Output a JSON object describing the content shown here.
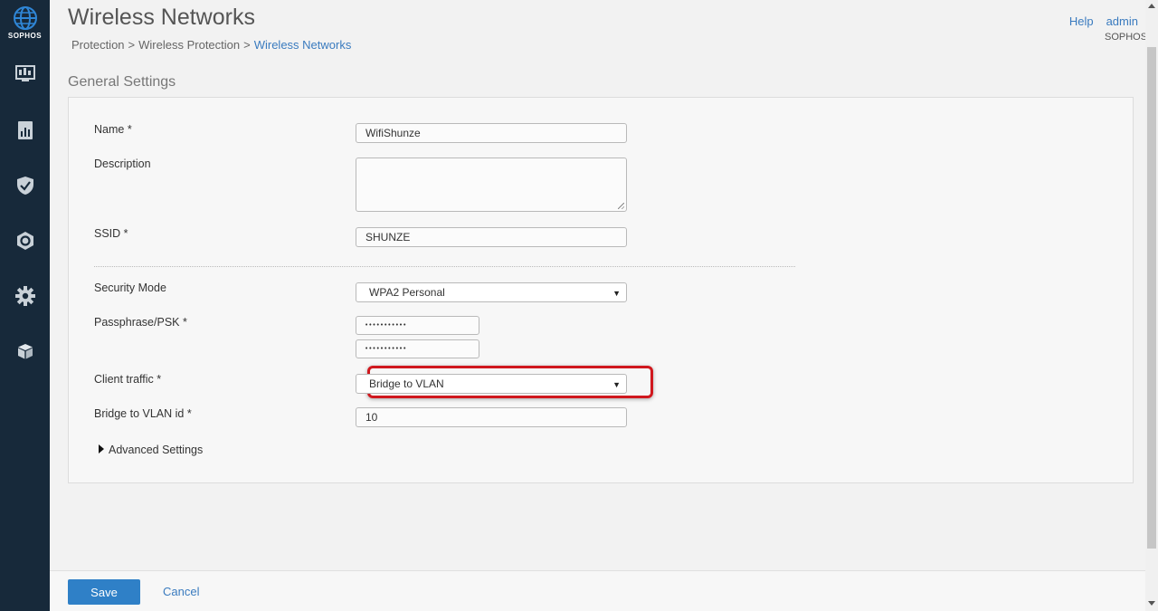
{
  "sidebar": {
    "logo_text": "SOPHOS",
    "items": [
      {
        "icon": "monitor-icon"
      },
      {
        "icon": "reports-icon"
      },
      {
        "icon": "shield-icon"
      },
      {
        "icon": "protect-icon"
      },
      {
        "icon": "gear-icon"
      },
      {
        "icon": "box-icon"
      }
    ]
  },
  "header": {
    "title": "Wireless Networks",
    "breadcrumb": [
      "Protection",
      "Wireless Protection",
      "Wireless Networks"
    ],
    "breadcrumb_sep": ">",
    "help": "Help",
    "user": "admin",
    "company": "SOPHOS"
  },
  "section": {
    "title": "General Settings"
  },
  "form": {
    "name": {
      "label": "Name *",
      "value": "WifiShunze"
    },
    "description": {
      "label": "Description",
      "value": ""
    },
    "ssid": {
      "label": "SSID *",
      "value": "SHUNZE"
    },
    "security_mode": {
      "label": "Security Mode",
      "value": "WPA2 Personal"
    },
    "passphrase": {
      "label": "Passphrase/PSK *",
      "value": "•••••••••••",
      "confirm": "•••••••••••"
    },
    "client_traffic": {
      "label": "Client traffic *",
      "value": "Bridge to VLAN"
    },
    "vlan_id": {
      "label": "Bridge to VLAN id *",
      "value": "10"
    },
    "advanced": {
      "label": "Advanced Settings"
    }
  },
  "footer": {
    "save": "Save",
    "cancel": "Cancel"
  },
  "colors": {
    "sidebar": "#17293a",
    "accent": "#2f80c7",
    "link": "#3a7bbf",
    "highlight": "#d0181e"
  }
}
